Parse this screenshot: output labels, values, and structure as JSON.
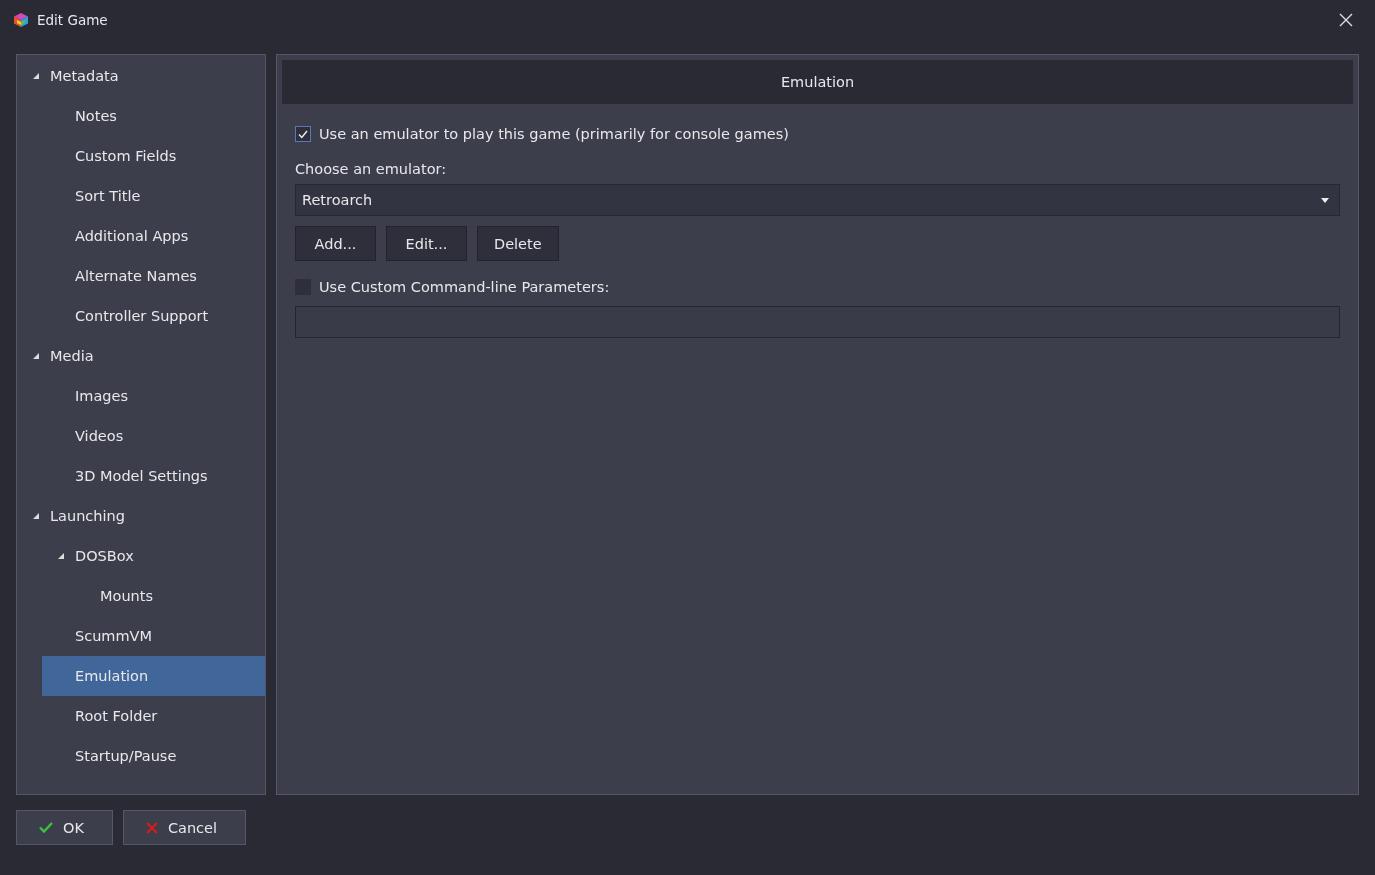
{
  "window": {
    "title": "Edit Game"
  },
  "sidebar": {
    "items": [
      {
        "label": "Metadata",
        "expanded": true,
        "selected": false,
        "children": [
          {
            "label": "Notes",
            "selected": false
          },
          {
            "label": "Custom Fields",
            "selected": false
          },
          {
            "label": "Sort Title",
            "selected": false
          },
          {
            "label": "Additional Apps",
            "selected": false
          },
          {
            "label": "Alternate Names",
            "selected": false
          },
          {
            "label": "Controller Support",
            "selected": false
          }
        ]
      },
      {
        "label": "Media",
        "expanded": true,
        "selected": false,
        "children": [
          {
            "label": "Images",
            "selected": false
          },
          {
            "label": "Videos",
            "selected": false
          },
          {
            "label": "3D Model Settings",
            "selected": false
          }
        ]
      },
      {
        "label": "Launching",
        "expanded": true,
        "selected": false,
        "children": [
          {
            "label": "DOSBox",
            "expanded": true,
            "selected": false,
            "children": [
              {
                "label": "Mounts",
                "selected": false
              }
            ]
          },
          {
            "label": "ScummVM",
            "selected": false
          },
          {
            "label": "Emulation",
            "selected": true
          },
          {
            "label": "Root Folder",
            "selected": false
          },
          {
            "label": "Startup/Pause",
            "selected": false
          }
        ]
      }
    ]
  },
  "panel": {
    "title": "Emulation",
    "use_emulator": {
      "label": "Use an emulator to play this game (primarily for console games)",
      "checked": true
    },
    "emulator_label": "Choose an emulator:",
    "emulator": {
      "value": "Retroarch"
    },
    "buttons": [
      "Add...",
      "Edit...",
      "Delete"
    ],
    "custom_params": {
      "label": "Use Custom Command-line Parameters:",
      "checked": false
    }
  },
  "footer": {
    "buttons": [
      {
        "label": "OK",
        "kind": "ok"
      },
      {
        "label": "Cancel",
        "kind": "cancel"
      }
    ]
  }
}
